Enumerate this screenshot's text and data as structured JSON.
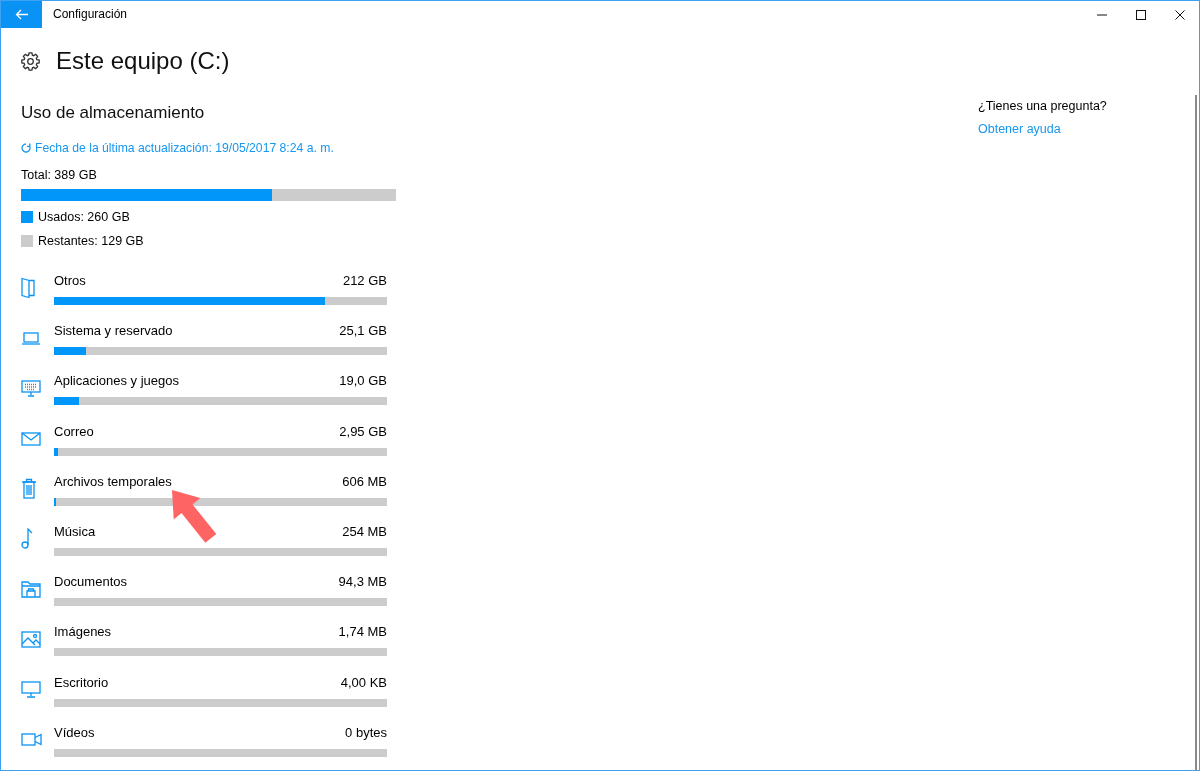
{
  "window": {
    "title": "Configuración"
  },
  "page": {
    "title": "Este equipo (C:)"
  },
  "storage": {
    "heading": "Uso de almacenamiento",
    "updated": "Fecha de la última actualización: 19/05/2017 8:24 a. m.",
    "total": "Total: 389 GB",
    "level": 0.668,
    "legend": [
      {
        "label": "Usados: 260 GB",
        "color": "#0096fa"
      },
      {
        "label": "Restantes: 129 GB",
        "color": "#cccccc"
      }
    ]
  },
  "categories": [
    {
      "kind": "other",
      "name": "Otros",
      "size": "212 GB",
      "level": 0.815
    },
    {
      "kind": "system",
      "name": "Sistema y reservado",
      "size": "25,1 GB",
      "level": 0.097
    },
    {
      "kind": "apps",
      "name": "Aplicaciones y juegos",
      "size": "19,0 GB",
      "level": 0.075
    },
    {
      "kind": "mail",
      "name": "Correo",
      "size": "2,95 GB",
      "level": 0.013
    },
    {
      "kind": "temp",
      "name": "Archivos temporales",
      "size": "606 MB",
      "level": 0.005
    },
    {
      "kind": "music",
      "name": "Música",
      "size": "254 MB"
    },
    {
      "kind": "documents",
      "name": "Documentos",
      "size": "94,3 MB"
    },
    {
      "kind": "pictures",
      "name": "Imágenes",
      "size": "1,74 MB"
    },
    {
      "kind": "desktop",
      "name": "Escritorio",
      "size": "4,00 KB"
    },
    {
      "kind": "videos",
      "name": "Vídeos",
      "size": "0 bytes"
    }
  ],
  "help": {
    "question": "¿Tienes una pregunta?",
    "link": "Obtener ayuda"
  },
  "annotations": [
    {
      "kind": "arrow"
    }
  ]
}
